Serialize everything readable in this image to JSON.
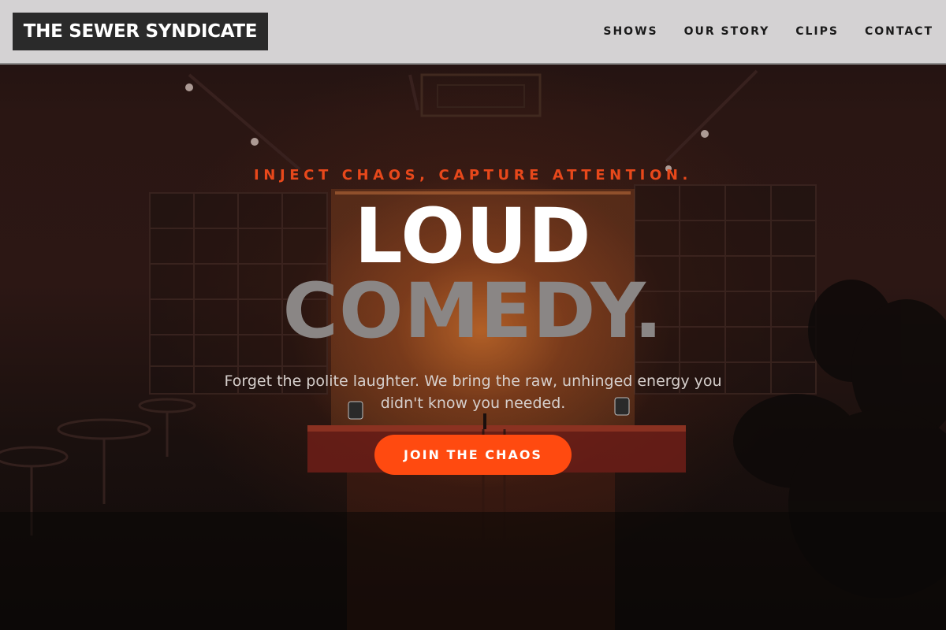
{
  "header": {
    "brand": "THE SEWER SYNDICATE",
    "nav": [
      {
        "label": "SHOWS"
      },
      {
        "label": "OUR STORY"
      },
      {
        "label": "CLIPS"
      },
      {
        "label": "CONTACT"
      }
    ]
  },
  "hero": {
    "tagline": "INJECT CHAOS, CAPTURE ATTENTION.",
    "headline_line1": "LOUD",
    "headline_line2": "COMEDY.",
    "description": "Forget the polite laughter. We bring the raw, unhinged energy you didn't know you needed.",
    "cta_label": "JOIN THE CHAOS",
    "background_image": "comedy-club-stage-photo"
  },
  "colors": {
    "accent": "#ff4a10",
    "tagline": "#e8481b",
    "header_bg": "#dcdbdc",
    "brand_bg": "#2a2a2a",
    "headline_primary": "#ffffff",
    "headline_secondary": "#8a8685"
  }
}
